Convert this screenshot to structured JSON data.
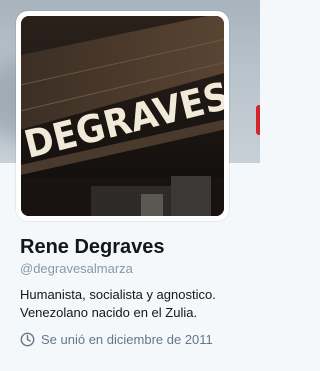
{
  "profile": {
    "name": "Rene Degraves",
    "handle": "@degravesalmarza",
    "bio_lines": [
      "Humanista, socialista y agnostico.",
      "Venezolano nacido en el Zulia."
    ],
    "joined": "Se unió en diciembre de 2011",
    "avatar_sign_text": "DEGRAVES"
  },
  "icons": {
    "joined": "clock-icon"
  },
  "colors": {
    "name": "#14171a",
    "handle": "#8899a6",
    "meta": "#657786",
    "background": "#f5f8fa"
  }
}
